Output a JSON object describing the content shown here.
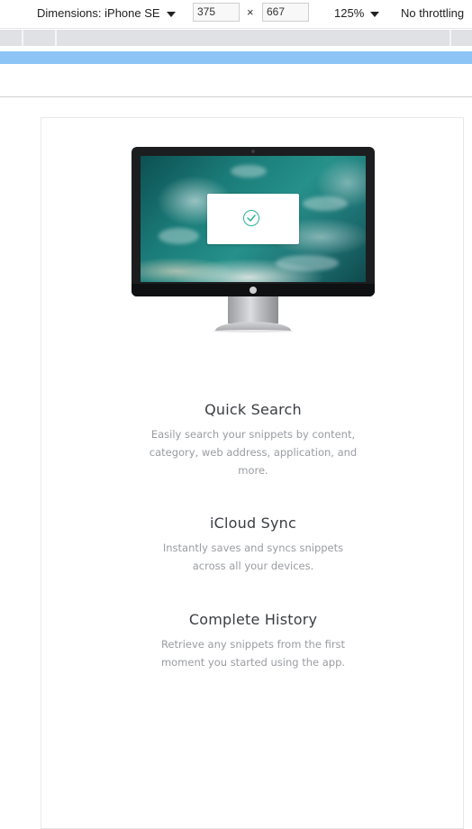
{
  "devtools": {
    "dimensions_label": "Dimensions: iPhone SE",
    "width_value": "375",
    "times_symbol": "×",
    "height_value": "667",
    "zoom_label": "125%",
    "throttling_label": "No throttling"
  },
  "colors": {
    "accent": "#2bb39a",
    "media_query_bar": "#8cc4f6",
    "title_text": "#3a3d42",
    "desc_text": "#9a9ca1"
  },
  "features": [
    {
      "title": "Quick Search",
      "desc_lines": [
        "Easily search your snippets by content,",
        "category, web address, application, and",
        "more."
      ]
    },
    {
      "title": "iCloud Sync",
      "desc_lines": [
        "Instantly saves and syncs snippets",
        "across all your devices."
      ]
    },
    {
      "title": "Complete History",
      "desc_lines": [
        "Retrieve any snippets from the first",
        "moment you started using the app."
      ]
    }
  ]
}
